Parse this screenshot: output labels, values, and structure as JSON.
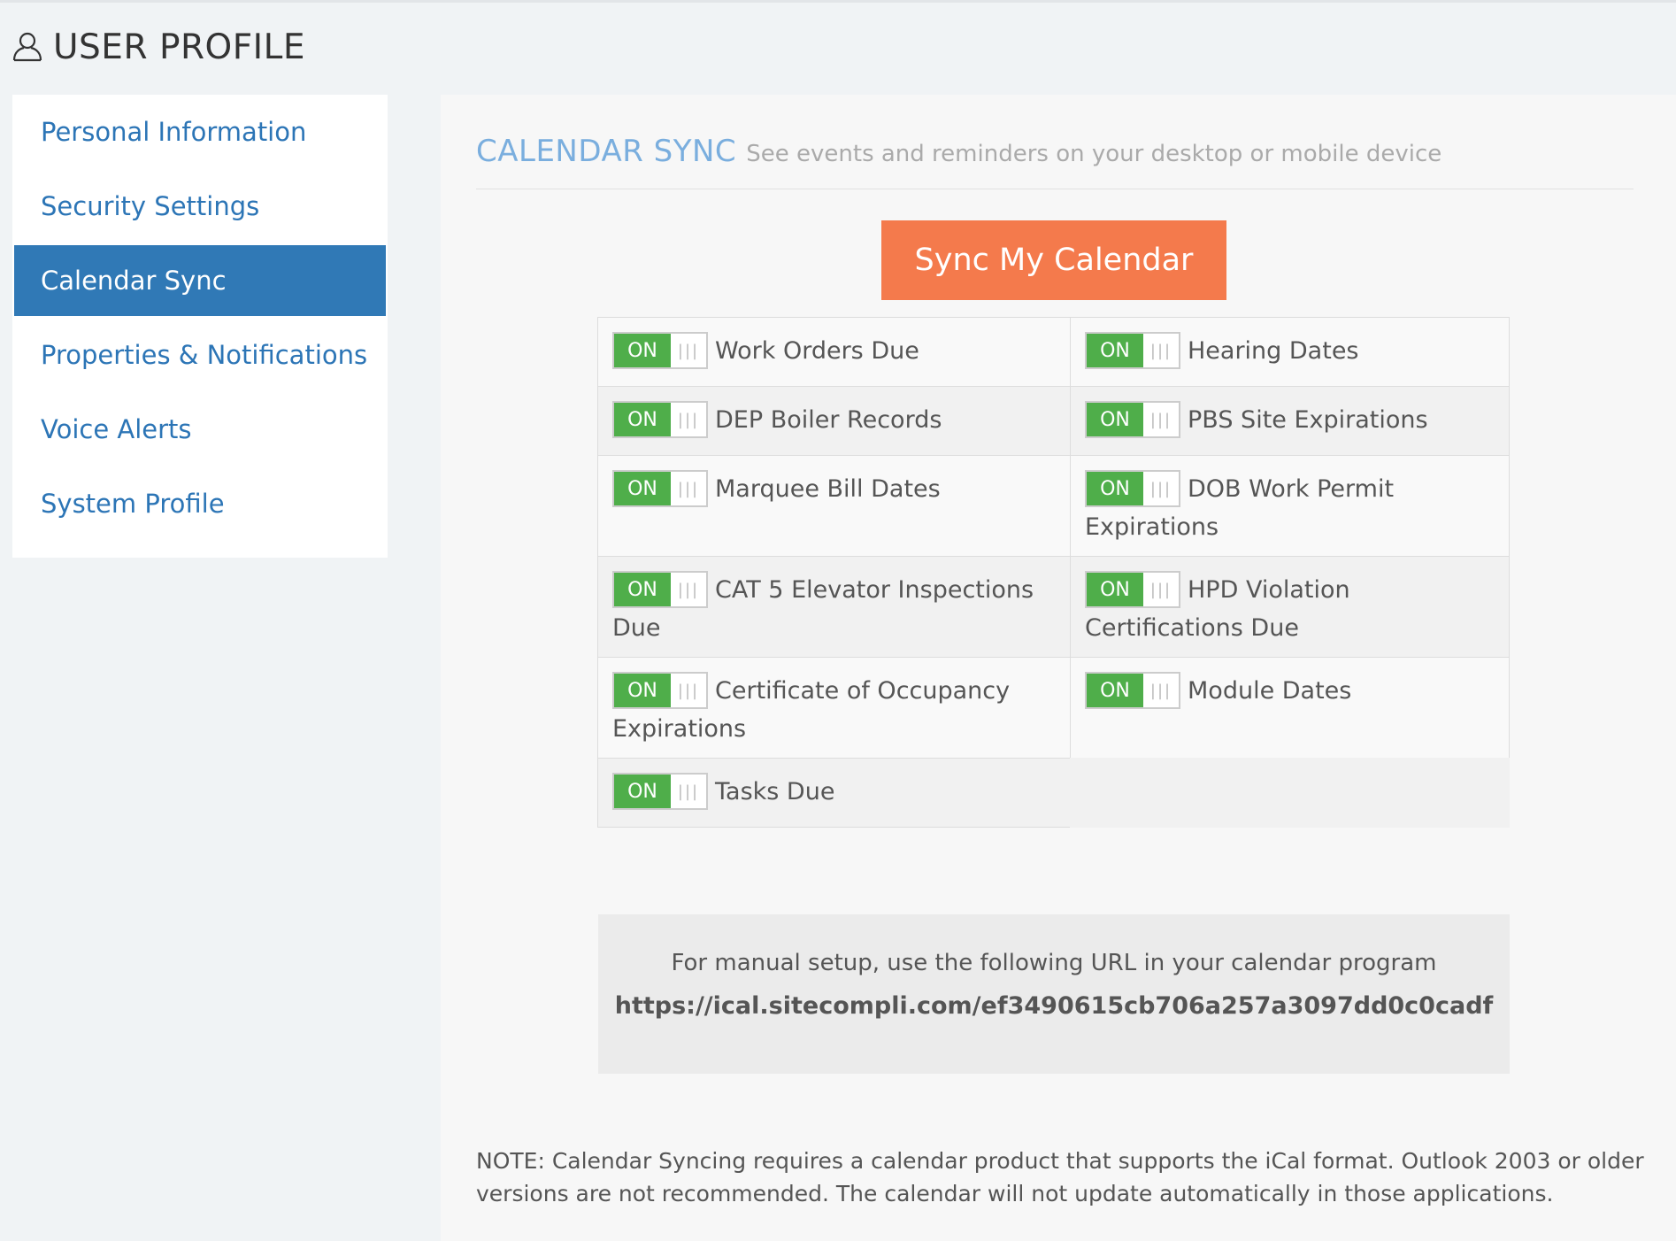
{
  "header": {
    "title": "USER PROFILE",
    "icon": "user-icon"
  },
  "sidebar": {
    "items": [
      {
        "label": "Personal Information",
        "active": false
      },
      {
        "label": "Security Settings",
        "active": false
      },
      {
        "label": "Calendar Sync",
        "active": true
      },
      {
        "label": "Properties & Notifications",
        "active": false
      },
      {
        "label": "Voice Alerts",
        "active": false
      },
      {
        "label": "System Profile",
        "active": false
      }
    ]
  },
  "calendar_sync": {
    "title": "CALENDAR SYNC",
    "subtitle": "See events and reminders on your desktop or mobile device",
    "sync_button": "Sync My Calendar",
    "toggle_on_label": "ON",
    "toggle_handle": "|||",
    "options": [
      {
        "label": "Work Orders Due",
        "state": "ON"
      },
      {
        "label": "Hearing Dates",
        "state": "ON"
      },
      {
        "label": "DEP Boiler Records",
        "state": "ON"
      },
      {
        "label": "PBS Site Expirations",
        "state": "ON"
      },
      {
        "label": "Marquee Bill Dates",
        "state": "ON"
      },
      {
        "label": "DOB Work Permit Expirations",
        "state": "ON"
      },
      {
        "label": "CAT 5 Elevator Inspections Due",
        "state": "ON"
      },
      {
        "label": "HPD Violation Certifications Due",
        "state": "ON"
      },
      {
        "label": "Certificate of Occupancy Expirations",
        "state": "ON"
      },
      {
        "label": "Module Dates",
        "state": "ON"
      },
      {
        "label": "Tasks Due",
        "state": "ON"
      }
    ],
    "manual": {
      "text": "For manual setup, use the following URL in your calendar program",
      "url": "https://ical.sitecompli.com/ef3490615cb706a257a3097dd0c0cadf"
    },
    "note": "NOTE: Calendar Syncing requires a calendar product that supports the iCal format. Outlook 2003 or older versions are not recommended. The calendar will not update automatically in those applications."
  },
  "colors": {
    "accent_blue": "#3079b6",
    "link_blue": "#2c75b6",
    "section_title": "#7aaede",
    "sync_button": "#f47a4c",
    "toggle_on": "#4fae4a"
  }
}
